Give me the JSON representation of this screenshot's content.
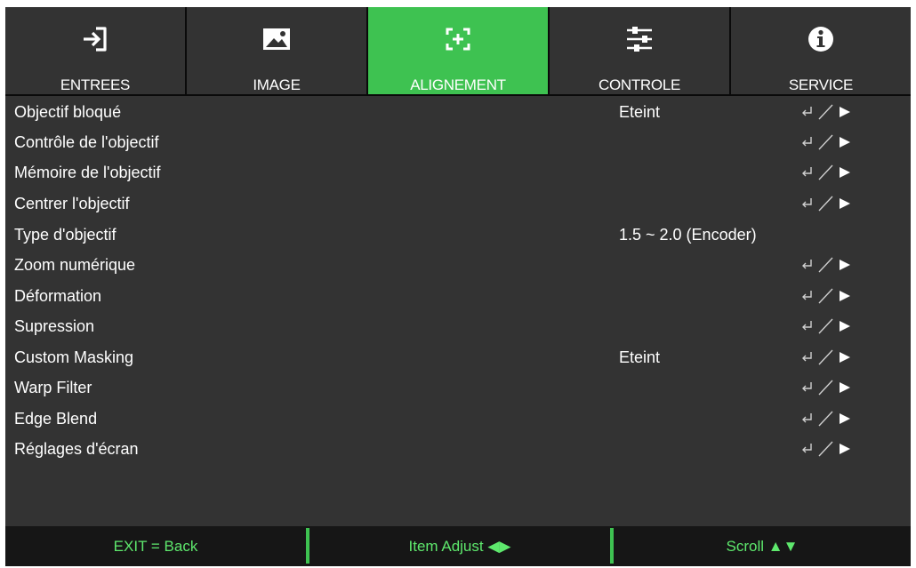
{
  "tabs": [
    {
      "label": "ENTREES",
      "icon": "input-icon",
      "active": false
    },
    {
      "label": "IMAGE",
      "icon": "image-icon",
      "active": false
    },
    {
      "label": "ALIGNEMENT",
      "icon": "alignment-icon",
      "active": true
    },
    {
      "label": "CONTROLE",
      "icon": "sliders-icon",
      "active": false
    },
    {
      "label": "SERVICE",
      "icon": "info-icon",
      "active": false
    }
  ],
  "menu": {
    "items": [
      {
        "label": "Objectif bloqué",
        "value": "Eteint"
      },
      {
        "label": "Contrôle de l'objectif",
        "value": ""
      },
      {
        "label": "Mémoire de l'objectif",
        "value": ""
      },
      {
        "label": "Centrer l'objectif",
        "value": ""
      },
      {
        "label": "Type d'objectif",
        "value": "1.5 ~ 2.0 (Encoder)"
      },
      {
        "label": "Zoom numérique",
        "value": ""
      },
      {
        "label": "Déformation",
        "value": ""
      },
      {
        "label": "Supression",
        "value": ""
      },
      {
        "label": "Custom Masking",
        "value": "Eteint"
      },
      {
        "label": "Warp Filter",
        "value": ""
      },
      {
        "label": "Edge Blend",
        "value": ""
      },
      {
        "label": "Réglages d'écran",
        "value": ""
      }
    ]
  },
  "footer": {
    "exit": "EXIT = Back",
    "adjust": "Item Adjust ◀▶",
    "scroll": "Scroll ▲▼"
  },
  "colors": {
    "accent": "#3ec251",
    "footer_text": "#5ee86d",
    "panel": "#333333",
    "background": "#0a0a0a"
  }
}
